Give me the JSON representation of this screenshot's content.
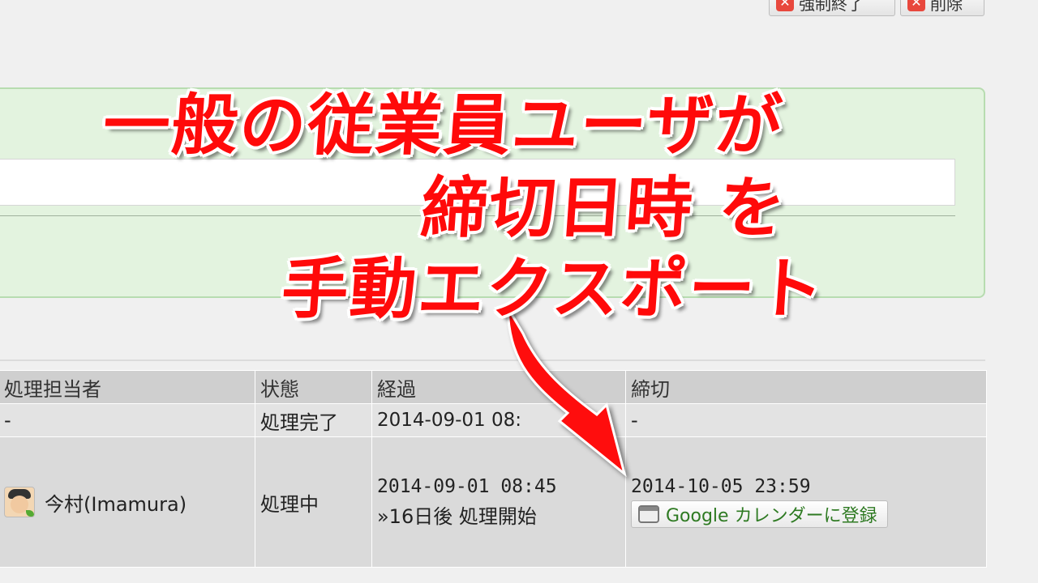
{
  "toolbar": {
    "force_end_label": "強制終了",
    "delete_label": "削除"
  },
  "table": {
    "headers": [
      "処理担当者",
      "状態",
      "経過",
      "締切"
    ],
    "rows": [
      {
        "assignee": "-",
        "status": "処理完了",
        "elapsed": "2014-09-01 08:",
        "deadline": "-"
      },
      {
        "assignee": "今村(Imamura)",
        "status": "処理中",
        "elapsed": "2014-09-01 08:45",
        "elapsed_note": "»16日後 処理開始",
        "deadline": "2014-10-05 23:59",
        "calendar_button": "Google カレンダーに登録"
      }
    ]
  },
  "caption": {
    "line1": "一般の従業員ユーザが",
    "line2": "締切日時 を",
    "line3": "手動エクスポート"
  },
  "colors": {
    "caption": "#ff0a0a",
    "panel": "#e3f3df",
    "calendar_link": "#2e7a22"
  },
  "icons": [
    "close-icon",
    "delete-icon",
    "avatar-icon",
    "calendar-icon",
    "arrow-icon"
  ]
}
